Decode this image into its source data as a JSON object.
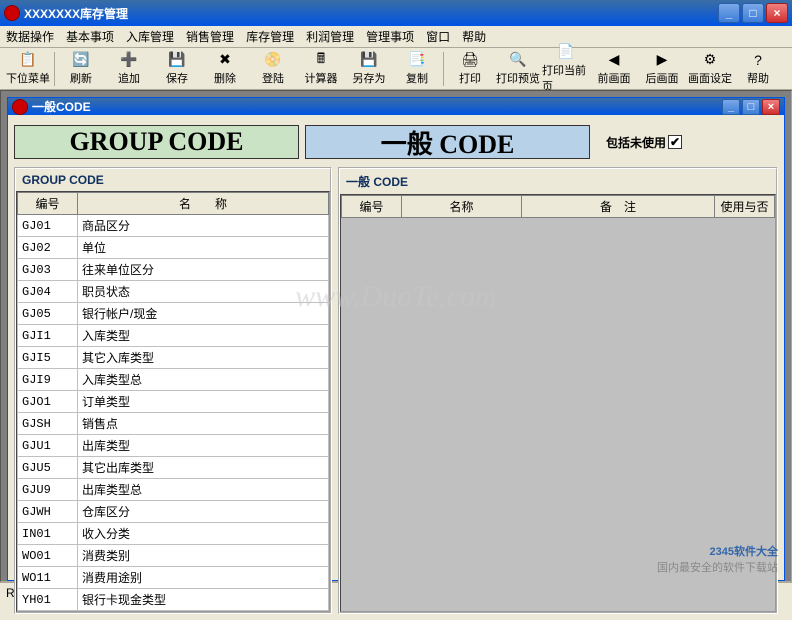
{
  "window": {
    "title": "XXXXXXX库存管理"
  },
  "menu": [
    "数据操作",
    "基本事项",
    "入库管理",
    "销售管理",
    "库存管理",
    "利润管理",
    "管理事项",
    "窗口",
    "帮助"
  ],
  "toolbar": [
    {
      "icon": "📋",
      "label": "下位菜单"
    },
    {
      "icon": "🔄",
      "label": "刷新"
    },
    {
      "icon": "➕",
      "label": "追加"
    },
    {
      "icon": "💾",
      "label": "保存"
    },
    {
      "icon": "✖",
      "label": "删除"
    },
    {
      "icon": "📀",
      "label": "登陆"
    },
    {
      "icon": "🖩",
      "label": "计算器"
    },
    {
      "icon": "💾",
      "label": "另存为"
    },
    {
      "icon": "📑",
      "label": "复制"
    },
    {
      "icon": "🖨",
      "label": "打印"
    },
    {
      "icon": "🔍",
      "label": "打印预览"
    },
    {
      "icon": "📄",
      "label": "打印当前页"
    },
    {
      "icon": "◀",
      "label": "前画面"
    },
    {
      "icon": "▶",
      "label": "后画面"
    },
    {
      "icon": "⚙",
      "label": "画面设定"
    },
    {
      "icon": "?",
      "label": "帮助"
    }
  ],
  "child": {
    "title": "一般CODE"
  },
  "tabs": {
    "group": "GROUP CODE",
    "general": "一般 CODE"
  },
  "checkbox": {
    "label": "包括未使用"
  },
  "leftPanel": {
    "title": "GROUP CODE",
    "cols": [
      "编号",
      "名　　称"
    ],
    "rows": [
      {
        "code": "GJ01",
        "name": "商品区分"
      },
      {
        "code": "GJ02",
        "name": "单位"
      },
      {
        "code": "GJ03",
        "name": "往来单位区分"
      },
      {
        "code": "GJ04",
        "name": "职员状态"
      },
      {
        "code": "GJ05",
        "name": "银行帐户/现金"
      },
      {
        "code": "GJI1",
        "name": "入库类型"
      },
      {
        "code": "GJI5",
        "name": "其它入库类型"
      },
      {
        "code": "GJI9",
        "name": "入库类型总"
      },
      {
        "code": "GJO1",
        "name": "订单类型"
      },
      {
        "code": "GJSH",
        "name": "销售点"
      },
      {
        "code": "GJU1",
        "name": "出库类型"
      },
      {
        "code": "GJU5",
        "name": "其它出库类型"
      },
      {
        "code": "GJU9",
        "name": "出库类型总"
      },
      {
        "code": "GJWH",
        "name": "仓库区分"
      },
      {
        "code": "IN01",
        "name": "收入分类"
      },
      {
        "code": "WO01",
        "name": "消费类别"
      },
      {
        "code": "WO11",
        "name": "消费用途别"
      },
      {
        "code": "YH01",
        "name": "银行卡现金类型"
      }
    ]
  },
  "rightPanel": {
    "title": "一般 CODE",
    "cols": [
      "编号",
      "名称",
      "备　注",
      "使用与否"
    ]
  },
  "status": "Ready",
  "watermark": "www.DuoTe.com",
  "watermark2a": "2345软件大全",
  "watermark2b": "国内最安全的软件下载站"
}
